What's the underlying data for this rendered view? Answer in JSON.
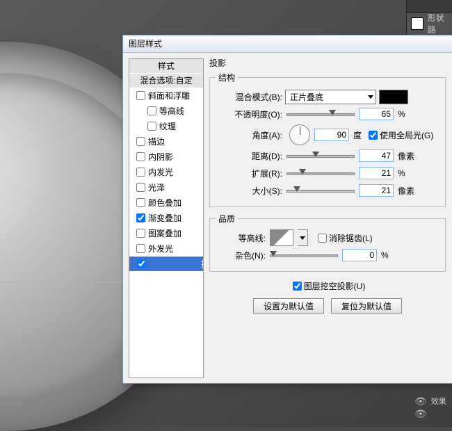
{
  "dialog": {
    "title": "图层样式"
  },
  "styleList": {
    "header": "样式",
    "subheader": "混合选项:自定",
    "items": [
      {
        "label": "斜面和浮雕",
        "checked": false,
        "indent": false
      },
      {
        "label": "等高线",
        "checked": false,
        "indent": true
      },
      {
        "label": "纹理",
        "checked": false,
        "indent": true
      },
      {
        "label": "描边",
        "checked": false,
        "indent": false
      },
      {
        "label": "内阴影",
        "checked": false,
        "indent": false
      },
      {
        "label": "内发光",
        "checked": false,
        "indent": false
      },
      {
        "label": "光泽",
        "checked": false,
        "indent": false
      },
      {
        "label": "颜色叠加",
        "checked": false,
        "indent": false
      },
      {
        "label": "渐变叠加",
        "checked": true,
        "indent": false
      },
      {
        "label": "图案叠加",
        "checked": false,
        "indent": false
      },
      {
        "label": "外发光",
        "checked": false,
        "indent": false
      },
      {
        "label": "投影",
        "checked": true,
        "indent": false,
        "selected": true
      }
    ]
  },
  "panel": {
    "title": "投影",
    "structLegend": "结构",
    "blendModeLabel": "混合模式(B):",
    "blendModeValue": "正片叠底",
    "blendColor": "#000000",
    "opacityLabel": "不透明度(O):",
    "opacityValue": "65",
    "opacityUnit": "%",
    "angleLabel": "角度(A):",
    "angleValue": "90",
    "angleUnit": "度",
    "useGlobalLabel": "使用全局光(G)",
    "useGlobalChecked": true,
    "distanceLabel": "距离(D):",
    "distanceValue": "47",
    "distanceUnit": "像素",
    "spreadLabel": "扩展(R):",
    "spreadValue": "21",
    "spreadUnit": "%",
    "sizeLabel": "大小(S):",
    "sizeValue": "21",
    "sizeUnit": "像素",
    "qualityLegend": "品质",
    "contourLabel": "等高线:",
    "antiAliasLabel": "消除锯齿(L)",
    "antiAliasChecked": false,
    "noiseLabel": "杂色(N):",
    "noiseValue": "0",
    "noiseUnit": "%",
    "knockoutLabel": "图层挖空投影(U)",
    "knockoutChecked": true,
    "btnDefault": "设置为默认值",
    "btnReset": "复位为默认值"
  },
  "rightPanel": {
    "layerLabel": "形状路",
    "effectsLabel": "效果"
  }
}
